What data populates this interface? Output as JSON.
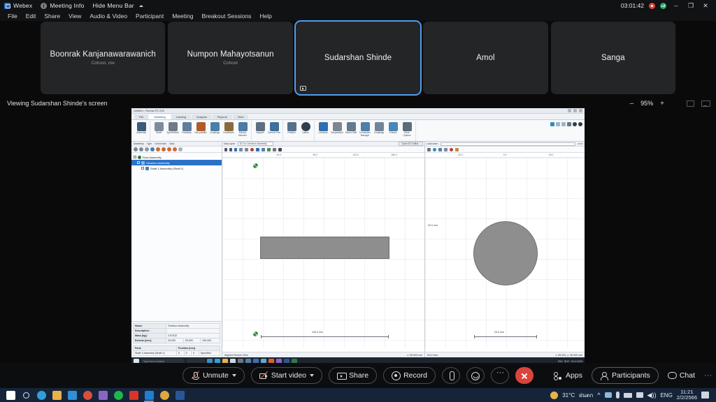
{
  "titlebar": {
    "app_name": "Webex",
    "meeting_info": "Meeting Info",
    "hide_menu_bar": "Hide Menu Bar",
    "timer": "03:01:42",
    "minimize": "–",
    "maximize": "❐",
    "close": "✕",
    "recording_icon": "record-dot-icon",
    "network_icon": "network-signal-icon"
  },
  "menubar": {
    "items": [
      {
        "label": "File"
      },
      {
        "label": "Edit"
      },
      {
        "label": "Share"
      },
      {
        "label": "View"
      },
      {
        "label": "Audio & Video"
      },
      {
        "label": "Participant"
      },
      {
        "label": "Meeting"
      },
      {
        "label": "Breakout Sessions"
      },
      {
        "label": "Help"
      }
    ]
  },
  "participants": {
    "tiles": [
      {
        "name": "Boonrak Kanjanawarawanich",
        "role": "Cohost, me",
        "active": false,
        "badge": false
      },
      {
        "name": "Numpon Mahayotsanun",
        "role": "Cohost",
        "active": false,
        "badge": false
      },
      {
        "name": "Sudarshan Shinde",
        "role": "",
        "active": true,
        "badge": true
      },
      {
        "name": "Amol",
        "role": "",
        "active": false,
        "badge": false
      },
      {
        "name": "Sanga",
        "role": "",
        "active": false,
        "badge": false
      }
    ]
  },
  "viewbar": {
    "viewing_text": "Viewing Sudarshan Shinde's screen",
    "zoom_out": "–",
    "zoom_value": "95%",
    "zoom_in": "+",
    "share_icon": "share-screen-icon",
    "fullscreen_icon": "fullscreen-icon"
  },
  "shared_screen": {
    "window_title": "Untitled - Romax RT-202",
    "tabs": [
      {
        "label": "File",
        "selected": false
      },
      {
        "label": "Modeling",
        "selected": true
      },
      {
        "label": "Loading",
        "selected": false
      },
      {
        "label": "Analysis",
        "selected": false
      },
      {
        "label": "Reports",
        "selected": false
      },
      {
        "label": "View",
        "selected": false
      }
    ],
    "ribbon_groups": [
      {
        "name": "Assembly",
        "items": [
          {
            "label": "Assembly",
            "color": "#3b5a78"
          }
        ]
      },
      {
        "name": "Add to current assembly",
        "items": [
          {
            "label": "Shaft",
            "color": "#7e8c99"
          },
          {
            "label": "Spur/Helical",
            "color": "#6d7c8a"
          },
          {
            "label": "Planetary",
            "color": "#5f7d9e"
          },
          {
            "label": "Non-parallel",
            "color": "#b05a2a"
          },
          {
            "label": "Couplings",
            "color": "#4b7fa8"
          },
          {
            "label": "Powertrain",
            "color": "#8a6a3c"
          },
          {
            "label": "Electric Machine",
            "color": "#4d7ba6"
          }
        ]
      },
      {
        "name": "Add to shaft",
        "items": [
          {
            "label": "Support",
            "color": "#5c6f80"
          },
          {
            "label": "Generic Part",
            "color": "#3e6f9e"
          }
        ]
      },
      {
        "name": "Position",
        "items": [
          {
            "label": "Position",
            "color": "#53718d"
          },
          {
            "label": "Datum",
            "color": "#2f3f4d"
          }
        ]
      },
      {
        "name": "Properties",
        "items": [
          {
            "label": "Lubricant",
            "color": "#2f6fb0"
          },
          {
            "label": "Temperature",
            "color": "#7d8791"
          },
          {
            "label": "Mount Shift",
            "color": "#63798d"
          },
          {
            "label": "Connection Manager",
            "color": "#4f7ea9"
          },
          {
            "label": "Couplings",
            "color": "#71859a"
          },
          {
            "label": "Checks",
            "color": "#4a87b5"
          },
          {
            "label": "More Options",
            "color": "#5d6b78"
          }
        ]
      }
    ],
    "tree_panel": {
      "tabs": [
        "Assembly",
        "Type",
        "Connection",
        "Data"
      ],
      "rows": [
        {
          "label": "Root Assembly",
          "indent": 0,
          "selected": false
        },
        {
          "label": "Gearbox Assembly",
          "indent": 1,
          "selected": true
        },
        {
          "label": "Shaft 1 Assembly (Shaft 1)",
          "indent": 2,
          "selected": false
        }
      ],
      "properties": [
        {
          "key": "Name:",
          "values": [
            "Gearbox Assembly",
            "",
            ""
          ]
        },
        {
          "key": "Description:",
          "values": [
            "",
            "",
            ""
          ]
        },
        {
          "key": "Mass [kg]:",
          "values": [
            "0.57422",
            "",
            ""
          ]
        },
        {
          "key": "Extents [mm]:",
          "values": [
            "25.000",
            "25.000",
            "150.000"
          ]
        }
      ],
      "parts_header": [
        "Parts",
        "Position [mm]"
      ],
      "parts_rows": [
        {
          "name": "Shaft 1 Assembly (Shaft 1)",
          "x": "0",
          "y": "0",
          "z": "0",
          "state": "Specified"
        }
      ]
    },
    "viewport_left": {
      "duty_cycle_label": "Duty cycle:",
      "duty_cycle_value": "DC for Gearbox Assembly",
      "editor_button": "Open DC Editor...",
      "ruler_ticks": [
        "40.0",
        "80.0",
        "120.0",
        "160.0"
      ],
      "dimension": "150.0 mm",
      "status_left": "Aligned Section View",
      "status_right": "z: 98.000 mm"
    },
    "viewport_right": {
      "load_case_label": "Load case:",
      "ruler_ticks": [
        "-20.0",
        "0.0",
        "20.0"
      ],
      "vertical_tick": "20.0 mm",
      "dimension": "25.0 mm",
      "status_left": "End View",
      "status_right": "x: 85.000, y: 36.000 mm"
    },
    "taskbar": {
      "search_placeholder": "Type here to search",
      "time": "09:57",
      "date": "02-02-2023",
      "lang": "ENG"
    }
  },
  "controls": {
    "mute": {
      "label": "Unmute",
      "icon": "mic-muted-icon",
      "has_caret": true
    },
    "video": {
      "label": "Start video",
      "icon": "camera-off-icon",
      "has_caret": true
    },
    "share": {
      "label": "Share",
      "icon": "share-screen-icon"
    },
    "record": {
      "label": "Record",
      "icon": "record-circle-icon"
    },
    "attach": {
      "icon": "paperclip-icon"
    },
    "reactions": {
      "icon": "reactions-smiley-icon"
    },
    "more": {
      "icon": "more-dots-icon"
    },
    "end": {
      "icon": "end-call-x-icon",
      "color": "#d9453d"
    },
    "apps": {
      "label": "Apps",
      "icon": "apps-grid-icon"
    },
    "participants": {
      "label": "Participants",
      "icon": "participants-person-icon"
    },
    "chat": {
      "label": "Chat",
      "icon": "chat-bubble-icon"
    },
    "overflow": {
      "icon": "more-dots-icon"
    }
  },
  "host_taskbar": {
    "icons": [
      {
        "name": "start-button-icon",
        "color": "#ffffff"
      },
      {
        "name": "search-icon",
        "color": "#dfe4ea"
      },
      {
        "name": "edge-browser-icon",
        "color": "#2f9fd8"
      },
      {
        "name": "file-explorer-icon",
        "color": "#e8b24a"
      },
      {
        "name": "mail-icon",
        "color": "#2f8fd8"
      },
      {
        "name": "chrome-icon",
        "color": "#d94f3d"
      },
      {
        "name": "onenote-icon",
        "color": "#8a66c4"
      },
      {
        "name": "line-app-icon",
        "color": "#20b54a"
      },
      {
        "name": "acrobat-reader-icon",
        "color": "#d9342b"
      },
      {
        "name": "webex-app-icon",
        "color": "#1f7fd0"
      },
      {
        "name": "romax-app-icon",
        "color": "#e0a83c"
      },
      {
        "name": "word-icon",
        "color": "#2a5699"
      }
    ],
    "weather_temp": "31°C",
    "weather_text": "ฝนตก",
    "lang": "ENG",
    "time": "11:21",
    "date": "2/2/2566",
    "tray_icons": [
      "chevron-up-icon",
      "onedrive-icon",
      "microphone-icon",
      "battery-icon",
      "network-icon",
      "volume-icon"
    ],
    "notification_count": "1"
  }
}
